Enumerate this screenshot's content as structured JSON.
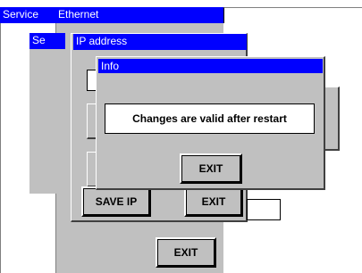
{
  "windows": {
    "service": {
      "title": "Service"
    },
    "ethernet": {
      "title": "Ethernet"
    },
    "sub_window": {
      "title": "Se"
    },
    "ip_address": {
      "title": "IP address",
      "save_ip_label": "SAVE IP",
      "exit_label": "EXIT"
    },
    "ethernet_exit_label": "EXIT",
    "info": {
      "title": "Info",
      "message": "Changes are valid after restart",
      "exit_label": "EXIT"
    }
  }
}
